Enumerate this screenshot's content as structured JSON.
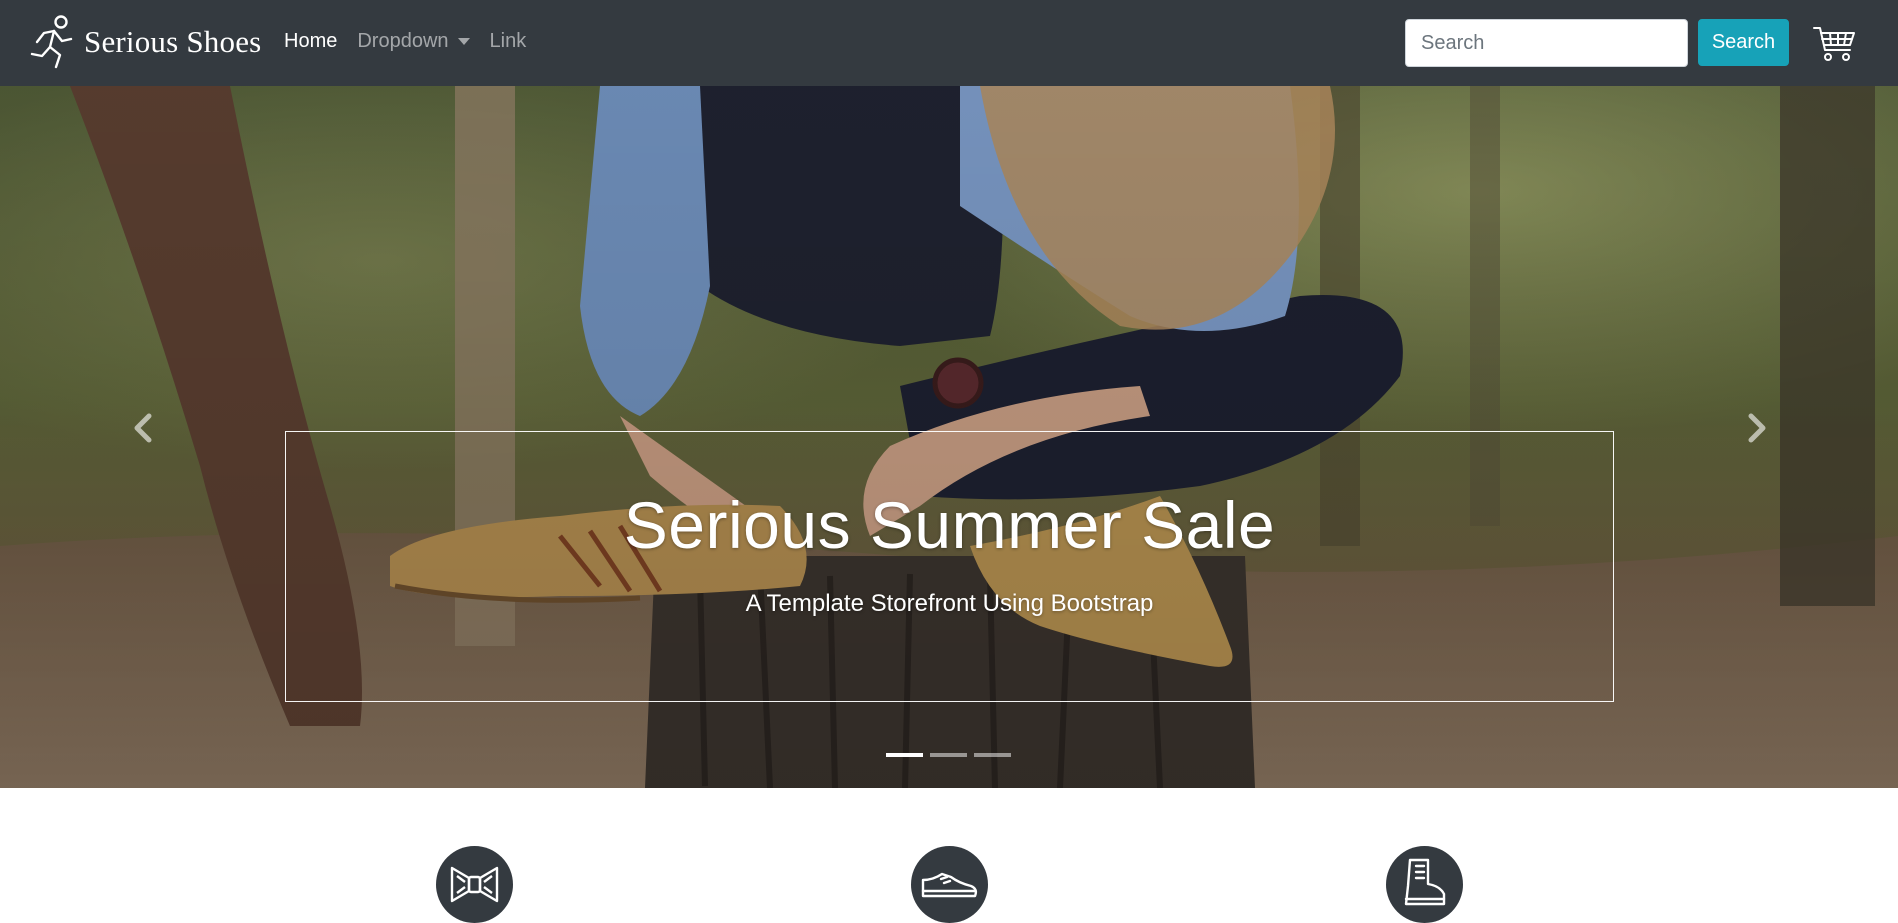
{
  "navbar": {
    "brand_logo_icon": "running-person-icon",
    "brand_name": "Serious Shoes",
    "links": [
      {
        "label": "Home",
        "active": true
      },
      {
        "label": "Dropdown",
        "active": false,
        "has_dropdown": true
      },
      {
        "label": "Link",
        "active": false
      }
    ],
    "search": {
      "placeholder": "Search",
      "value": "",
      "button_label": "Search"
    },
    "cart_icon": "shopping-cart-icon"
  },
  "hero": {
    "image": "person-sitting-on-tree-stump-wearing-tan-shoes-in-forest",
    "title": "Serious Summer Sale",
    "subtitle": "A Template Storefront Using Bootstrap",
    "prev_icon": "chevron-left-icon",
    "next_icon": "chevron-right-icon",
    "slides_count": 3,
    "active_slide": 1
  },
  "features": [
    {
      "icon": "bow-tie-icon"
    },
    {
      "icon": "dress-shoe-icon"
    },
    {
      "icon": "boot-icon"
    }
  ],
  "colors": {
    "navbar_bg": "#343a40",
    "search_button_bg": "#17a2b8",
    "feature_circle_bg": "#343a40"
  }
}
